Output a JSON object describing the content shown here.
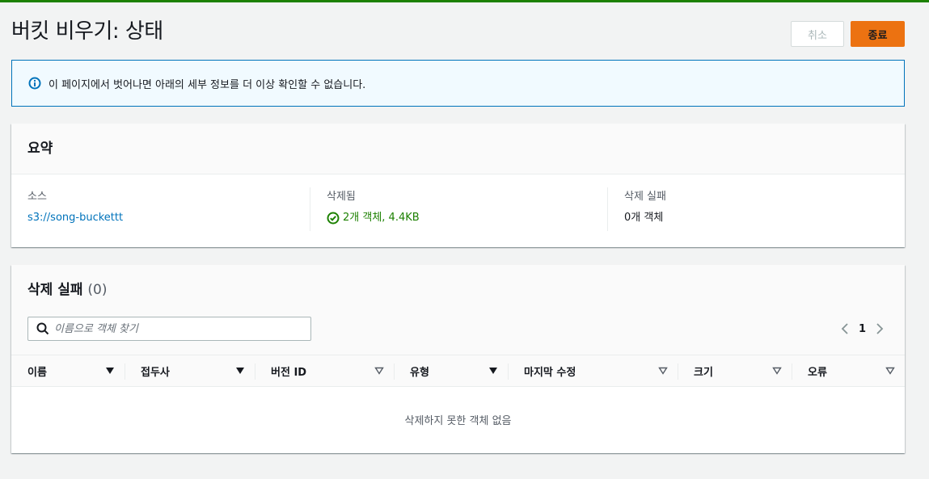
{
  "page": {
    "title": "버킷 비우기: 상태"
  },
  "actions": {
    "cancel_label": "취소",
    "exit_label": "종료"
  },
  "alert": {
    "icon": "info-icon",
    "message": "이 페이지에서 벗어나면 아래의 세부 정보를 더 이상 확인할 수 없습니다."
  },
  "summary": {
    "title": "요약",
    "source_label": "소스",
    "source_value": "s3://song-buckettt",
    "deleted_label": "삭제됨",
    "deleted_value": "2개 객체, 4.4KB",
    "failed_label": "삭제 실패",
    "failed_value": "0개 객체"
  },
  "failed_section": {
    "title": "삭제 실패",
    "count": "(0)",
    "search_placeholder": "이름으로 객체 찾기",
    "search_value": "",
    "current_page": "1",
    "columns": [
      {
        "label": "이름",
        "sort": "filled"
      },
      {
        "label": "접두사",
        "sort": "filled"
      },
      {
        "label": "버전 ID",
        "sort": "outline"
      },
      {
        "label": "유형",
        "sort": "filled"
      },
      {
        "label": "마지막 수정",
        "sort": "outline"
      },
      {
        "label": "크기",
        "sort": "outline"
      },
      {
        "label": "오류",
        "sort": "outline"
      }
    ],
    "empty_message": "삭제하지 못한 객체 없음"
  },
  "colors": {
    "accent_orange": "#ec7211",
    "success_green": "#1d8102",
    "link_blue": "#0073bb",
    "info_bg": "#f1faff"
  }
}
